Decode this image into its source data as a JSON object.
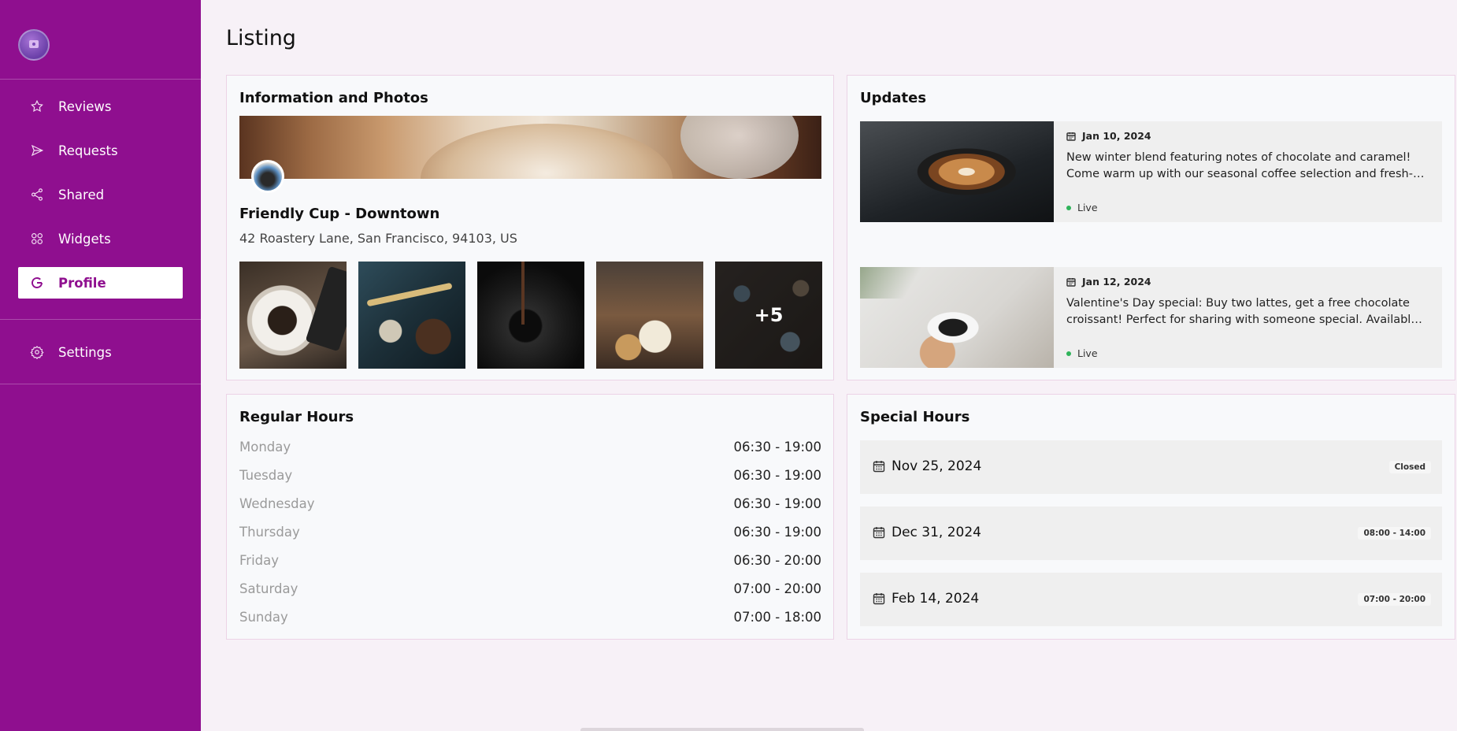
{
  "page": {
    "title": "Listing"
  },
  "sidebar": {
    "items": [
      {
        "label": "Reviews",
        "icon": "star-icon"
      },
      {
        "label": "Requests",
        "icon": "send-icon"
      },
      {
        "label": "Shared",
        "icon": "share-icon"
      },
      {
        "label": "Widgets",
        "icon": "widgets-icon"
      },
      {
        "label": "Profile",
        "icon": "google-icon",
        "active": true
      }
    ],
    "settings": {
      "label": "Settings",
      "icon": "gear-icon"
    }
  },
  "info": {
    "title": "Information and Photos",
    "name": "Friendly Cup - Downtown",
    "address": "42 Roastery Lane, San Francisco, 94103, US",
    "more_photos": "+5"
  },
  "updates": {
    "title": "Updates",
    "items": [
      {
        "date": "Jan 10, 2024",
        "text": "New winter blend featuring notes of chocolate and caramel! Come warm up with our seasonal coffee selection and fresh-baked pastries.",
        "status": "Live"
      },
      {
        "date": "Jan 12, 2024",
        "text": "Valentine's Day special: Buy two lattes, get a free chocolate croissant! Perfect for sharing with someone special. Available all week.",
        "status": "Live"
      }
    ]
  },
  "regular_hours": {
    "title": "Regular Hours",
    "rows": [
      {
        "day": "Monday",
        "time": "06:30 - 19:00"
      },
      {
        "day": "Tuesday",
        "time": "06:30 - 19:00"
      },
      {
        "day": "Wednesday",
        "time": "06:30 - 19:00"
      },
      {
        "day": "Thursday",
        "time": "06:30 - 19:00"
      },
      {
        "day": "Friday",
        "time": "06:30 - 20:00"
      },
      {
        "day": "Saturday",
        "time": "07:00 - 20:00"
      },
      {
        "day": "Sunday",
        "time": "07:00 - 18:00"
      }
    ]
  },
  "special_hours": {
    "title": "Special Hours",
    "items": [
      {
        "date": "Nov 25, 2024",
        "badge": "Closed"
      },
      {
        "date": "Dec 31, 2024",
        "badge": "08:00 - 14:00"
      },
      {
        "date": "Feb 14, 2024",
        "badge": "07:00 - 20:00"
      }
    ]
  },
  "colors": {
    "sidebar": "#8f0f8f",
    "live": "#2fb35a"
  }
}
